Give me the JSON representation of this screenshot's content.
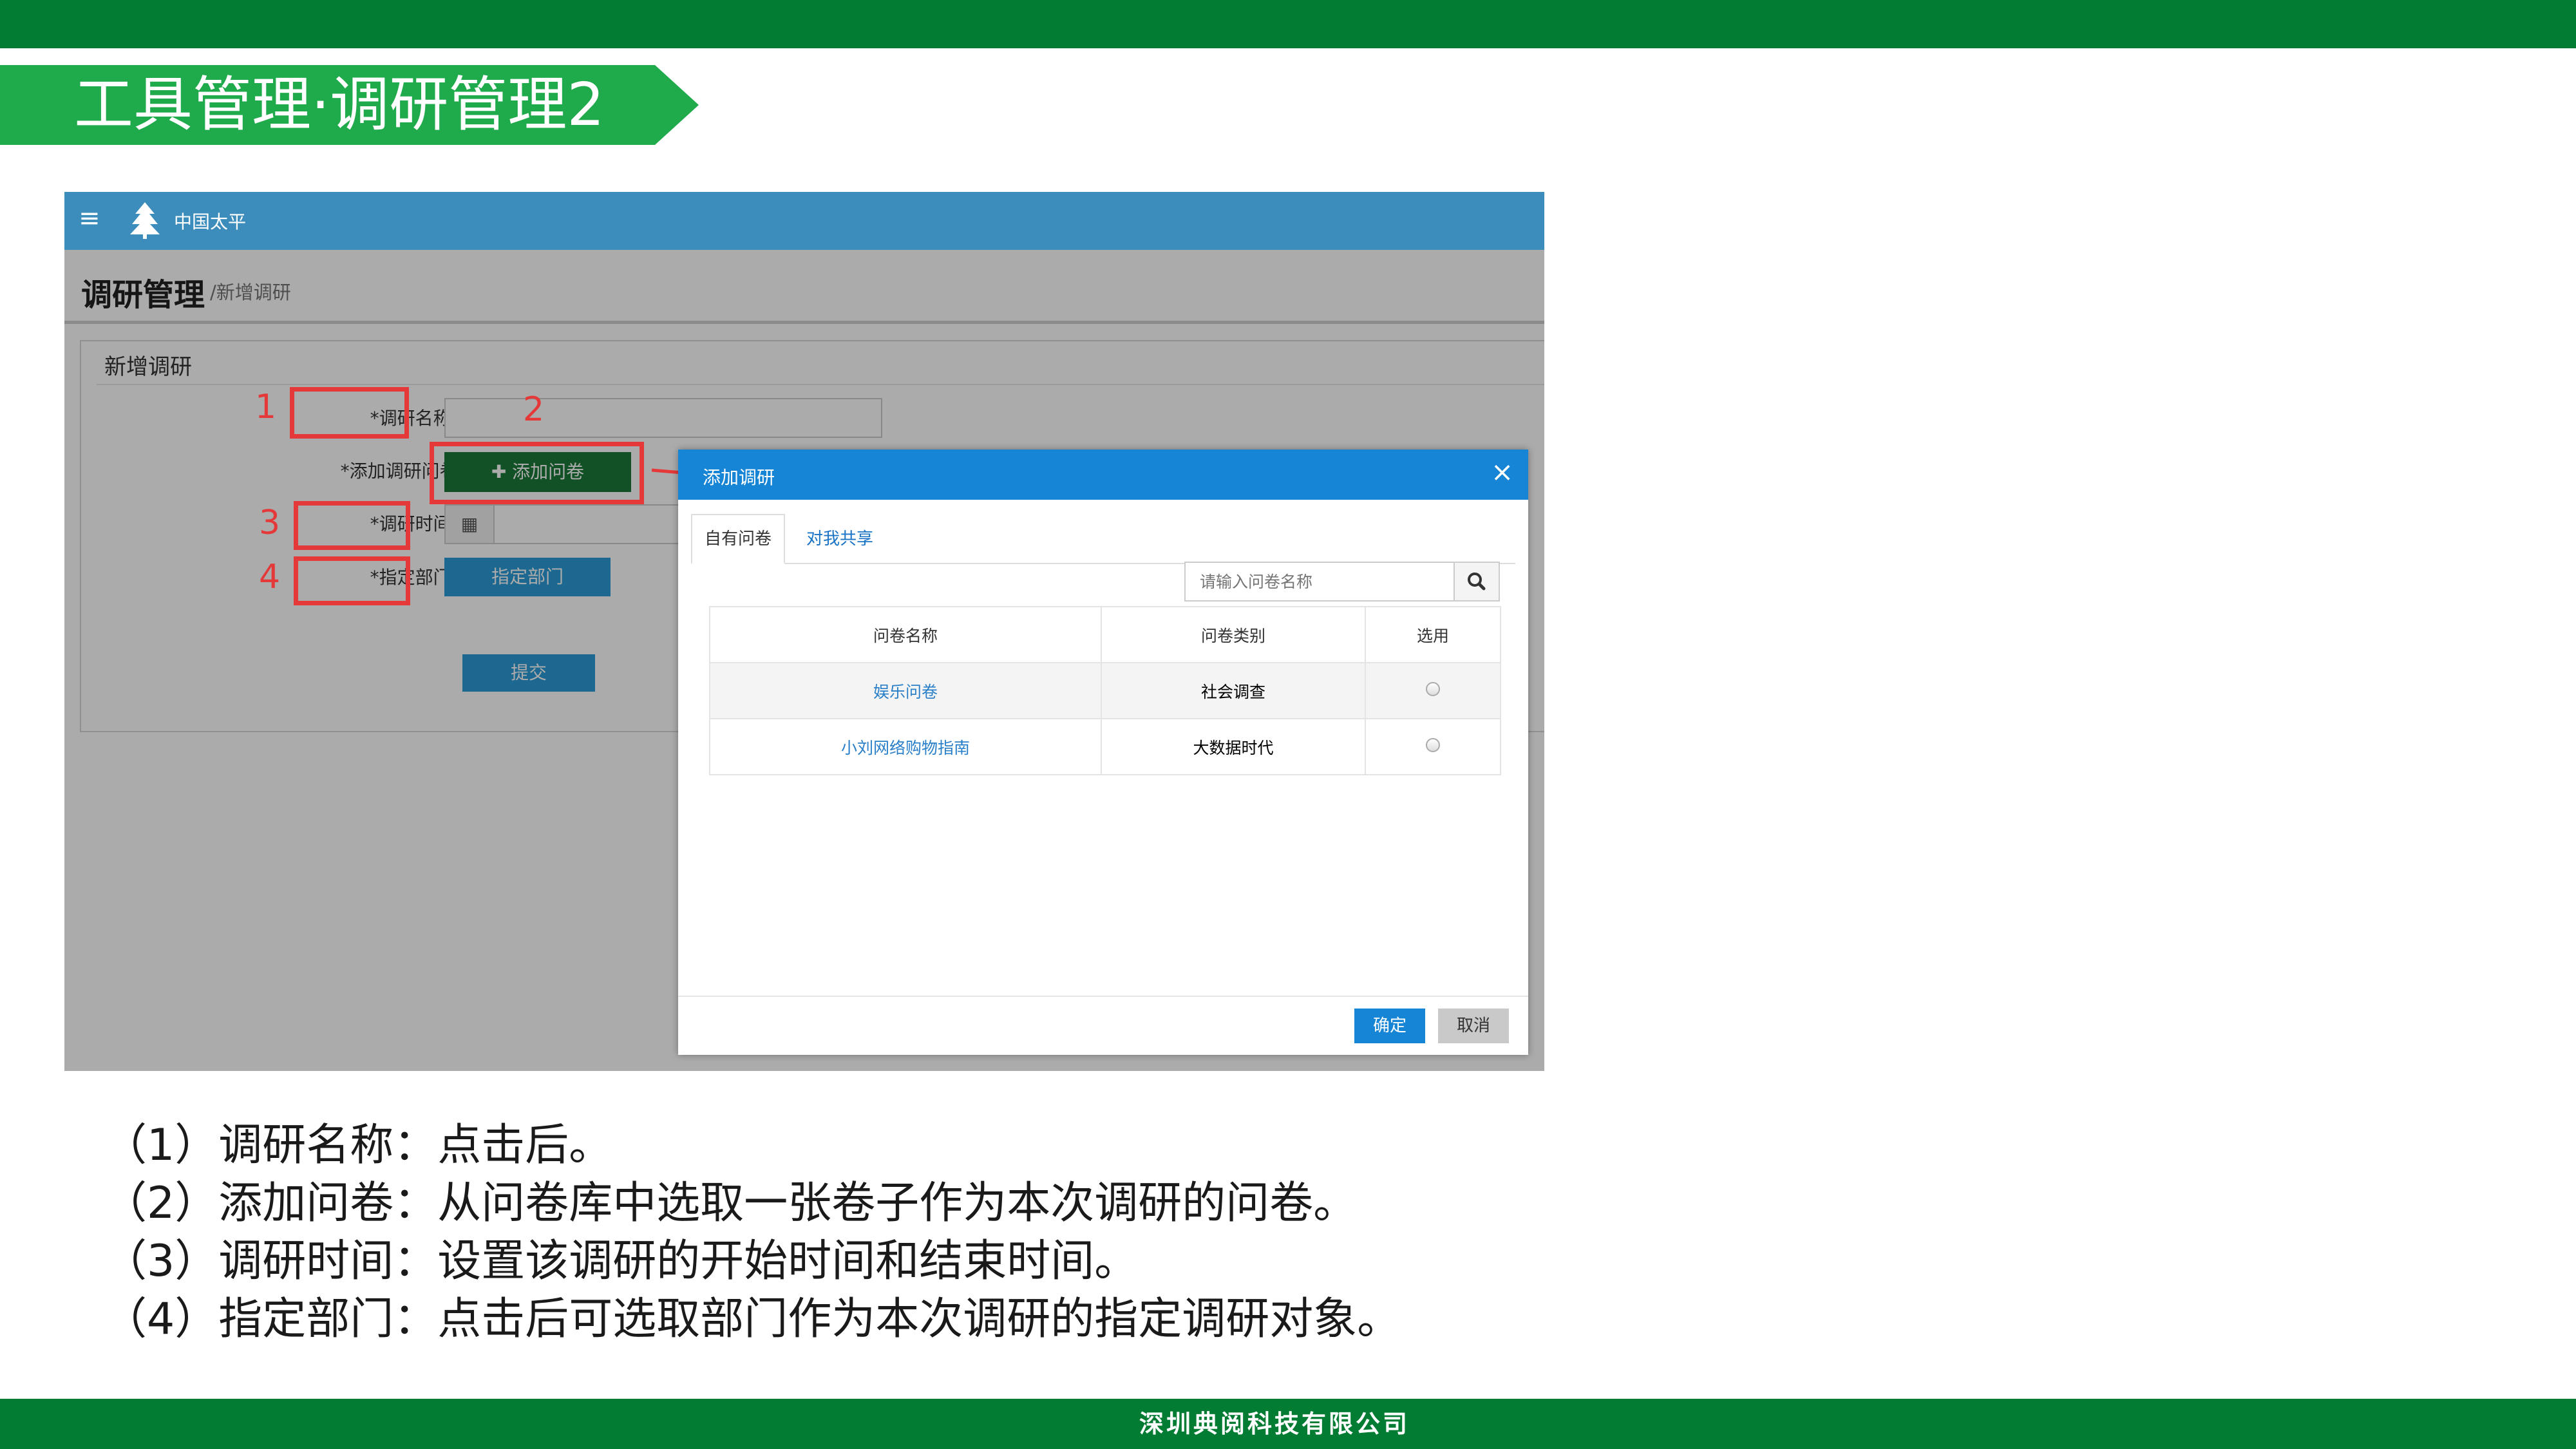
{
  "slide": {
    "title": "工具管理·调研管理2",
    "footer": "深圳典阅科技有限公司"
  },
  "app": {
    "brand": "中国太平",
    "page_title": "调研管理",
    "breadcrumb": "/新增调研",
    "card_title": "新增调研",
    "form": {
      "name_label": "*调研名称:",
      "questionnaire_label": "*添加调研问卷:",
      "add_button": "✚ 添加问卷",
      "time_label": "*调研时间:",
      "dept_label": "*指定部门:",
      "dept_button": "指定部门",
      "submit_button": "提交"
    }
  },
  "annotations": [
    "1",
    "2",
    "3",
    "4"
  ],
  "modal": {
    "title": "添加调研",
    "tabs": [
      "自有问卷",
      "对我共享"
    ],
    "search_placeholder": "请输入问卷名称",
    "columns": [
      "问卷名称",
      "问卷类别",
      "选用"
    ],
    "rows": [
      {
        "name": "娱乐问卷",
        "category": "社会调查"
      },
      {
        "name": "小刘网络购物指南",
        "category": "大数据时代"
      }
    ],
    "confirm": "确定",
    "cancel": "取消"
  },
  "descriptions": [
    "（1）调研名称：点击后。",
    "（2）添加问卷：从问卷库中选取一张卷子作为本次调研的问卷。",
    "（3）调研时间：设置该调研的开始时间和结束时间。",
    "（4）指定部门：点击后可选取部门作为本次调研的指定调研对象。"
  ],
  "colors": {
    "top_bar": "#017c32",
    "title_banner": "#1faa4b",
    "app_header": "#3c8dbc",
    "annotation_red": "#e53939",
    "modal_header": "#1685d6"
  }
}
